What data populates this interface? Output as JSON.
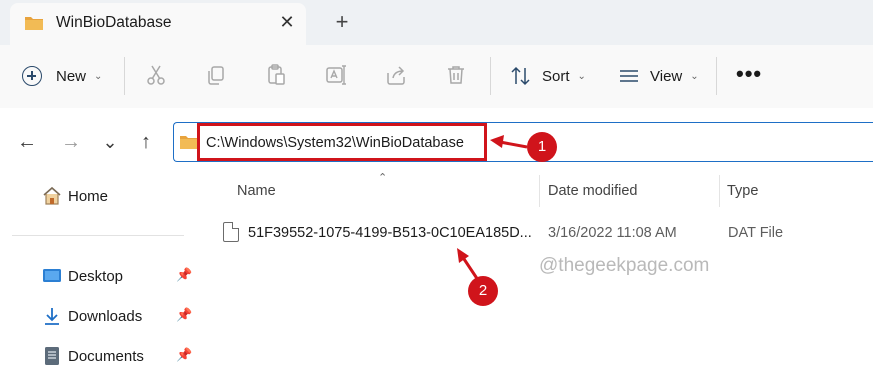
{
  "window": {
    "tab_title": "WinBioDatabase",
    "close_tab_glyph": "✕",
    "new_tab_glyph": "+"
  },
  "commandbar": {
    "new_label": "New",
    "sort_label": "Sort",
    "view_label": "View",
    "more_glyph": "•••",
    "icons": [
      "cut-icon",
      "copy-icon",
      "paste-icon",
      "rename-icon",
      "share-icon",
      "delete-icon"
    ]
  },
  "navigation": {
    "back_glyph": "←",
    "forward_glyph": "→",
    "recent_glyph": "⌄",
    "up_glyph": "↑"
  },
  "address": {
    "path": "C:\\Windows\\System32\\WinBioDatabase"
  },
  "sidebar": {
    "items": [
      {
        "label": "Home",
        "icon": "home-icon"
      },
      {
        "label": "Desktop",
        "icon": "desktop-icon",
        "pinned": true
      },
      {
        "label": "Downloads",
        "icon": "downloads-icon",
        "pinned": true
      },
      {
        "label": "Documents",
        "icon": "documents-icon",
        "pinned": true
      }
    ]
  },
  "columns": {
    "name": "Name",
    "date_modified": "Date modified",
    "type": "Type"
  },
  "files": [
    {
      "name": "51F39552-1075-4199-B513-0C10EA185D...",
      "date_modified": "3/16/2022 11:08 AM",
      "type": "DAT File"
    }
  ],
  "annotations": {
    "step1": "1",
    "step2": "2"
  },
  "watermark": "@thegeekpage.com",
  "colors": {
    "accent": "#1e6fc6",
    "annotation_red": "#d0141b",
    "folder_yellow": "#e8a33d"
  }
}
